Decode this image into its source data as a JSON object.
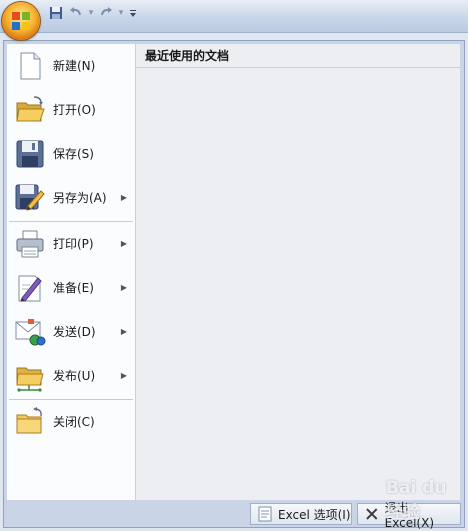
{
  "quick_access": {
    "save_icon": "save-icon",
    "undo_icon": "undo-icon",
    "redo_icon": "redo-icon",
    "customize_icon": "customize-dropdown-icon"
  },
  "recent_documents_title": "最近使用的文档",
  "menu_items": [
    {
      "label": "新建(N)",
      "icon": "new-document-icon"
    },
    {
      "label": "打开(O)",
      "icon": "open-folder-icon"
    },
    {
      "label": "保存(S)",
      "icon": "save-icon"
    },
    {
      "label": "另存为(A)",
      "icon": "save-as-icon"
    },
    {
      "label": "打印(P)",
      "icon": "print-icon"
    },
    {
      "label": "准备(E)",
      "icon": "prepare-icon"
    },
    {
      "label": "发送(D)",
      "icon": "send-icon"
    },
    {
      "label": "发布(U)",
      "icon": "publish-icon"
    },
    {
      "label": "关闭(C)",
      "icon": "close-folder-icon"
    }
  ],
  "footer": {
    "options_label": "Excel 选项(I)",
    "exit_label": "退出 Excel(X)"
  },
  "watermark": "Bai du 经验"
}
